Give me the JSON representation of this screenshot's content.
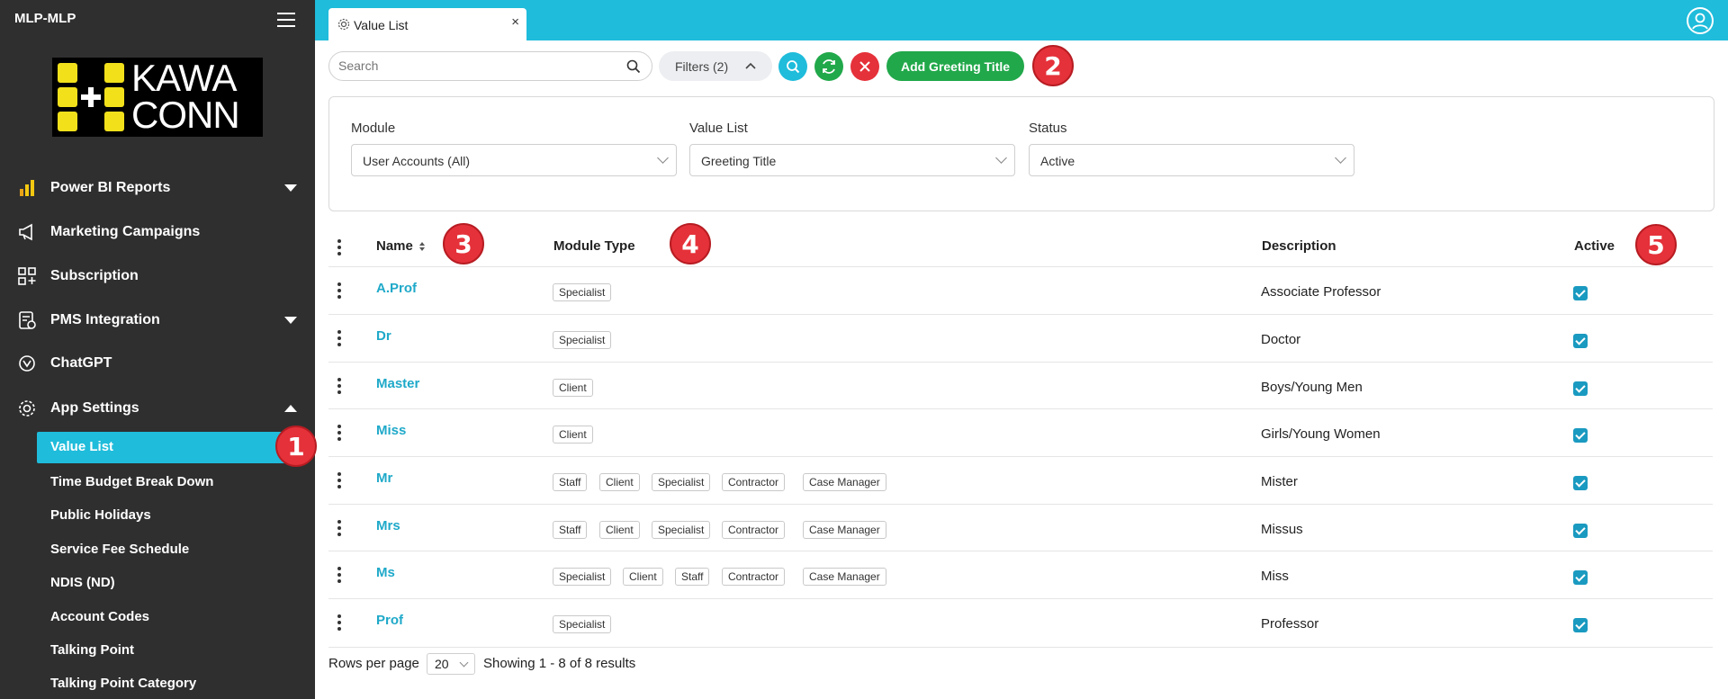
{
  "app": {
    "title": "MLP-MLP",
    "logo_text_line1": "KAWA",
    "logo_text_line2": "CONN"
  },
  "sidebar": {
    "items": [
      {
        "label": "Power BI Reports",
        "icon": "power-bi-icon"
      },
      {
        "label": "Marketing Campaigns",
        "icon": "megaphone-icon"
      },
      {
        "label": "Subscription",
        "icon": "subscription-icon"
      },
      {
        "label": "PMS Integration",
        "icon": "pms-icon"
      },
      {
        "label": "ChatGPT",
        "icon": "chatgpt-icon"
      },
      {
        "label": "App Settings",
        "icon": "gear-icon"
      }
    ],
    "sub_items": [
      "Value List",
      "Time Budget Break Down",
      "Public Holidays",
      "Service Fee Schedule",
      "NDIS (ND)",
      "Account Codes",
      "Talking Point",
      "Talking Point Category"
    ],
    "active_sub": "Value List"
  },
  "tab": {
    "label": "Value List",
    "close": "×"
  },
  "toolbar": {
    "search_placeholder": "Search",
    "filters_label": "Filters (2)",
    "add_label": "Add Greeting Title"
  },
  "filters": {
    "module_label": "Module",
    "module_value": "User Accounts (All)",
    "valuelist_label": "Value List",
    "valuelist_value": "Greeting Title",
    "status_label": "Status",
    "status_value": "Active"
  },
  "table": {
    "headers": {
      "name": "Name",
      "module_type": "Module Type",
      "description": "Description",
      "active": "Active"
    },
    "rows": [
      {
        "name": "A.Prof",
        "tags": [
          "Specialist"
        ],
        "description": "Associate Professor",
        "active": true
      },
      {
        "name": "Dr",
        "tags": [
          "Specialist"
        ],
        "description": "Doctor",
        "active": true
      },
      {
        "name": "Master",
        "tags": [
          "Client"
        ],
        "description": "Boys/Young Men",
        "active": true
      },
      {
        "name": "Miss",
        "tags": [
          "Client"
        ],
        "description": "Girls/Young Women",
        "active": true
      },
      {
        "name": "Mr",
        "tags": [
          "Staff",
          "Client",
          "Specialist",
          "Contractor",
          "Case Manager"
        ],
        "description": "Mister",
        "active": true
      },
      {
        "name": "Mrs",
        "tags": [
          "Staff",
          "Client",
          "Specialist",
          "Contractor",
          "Case Manager"
        ],
        "description": "Missus",
        "active": true
      },
      {
        "name": "Ms",
        "tags": [
          "Specialist",
          "Client",
          "Staff",
          "Contractor",
          "Case Manager"
        ],
        "description": "Miss",
        "active": true
      },
      {
        "name": "Prof",
        "tags": [
          "Specialist"
        ],
        "description": "Professor",
        "active": true
      }
    ]
  },
  "pagination": {
    "rows_label": "Rows per page",
    "rows_value": "20",
    "showing": "Showing 1 - 8 of 8 results"
  },
  "annotations": [
    "1",
    "2",
    "3",
    "4",
    "5"
  ],
  "colors": {
    "accent": "#1fbcdb",
    "sidebar": "#2f2f2f",
    "success": "#21a84a",
    "danger": "#e5313a",
    "link": "#1fa9c9"
  }
}
